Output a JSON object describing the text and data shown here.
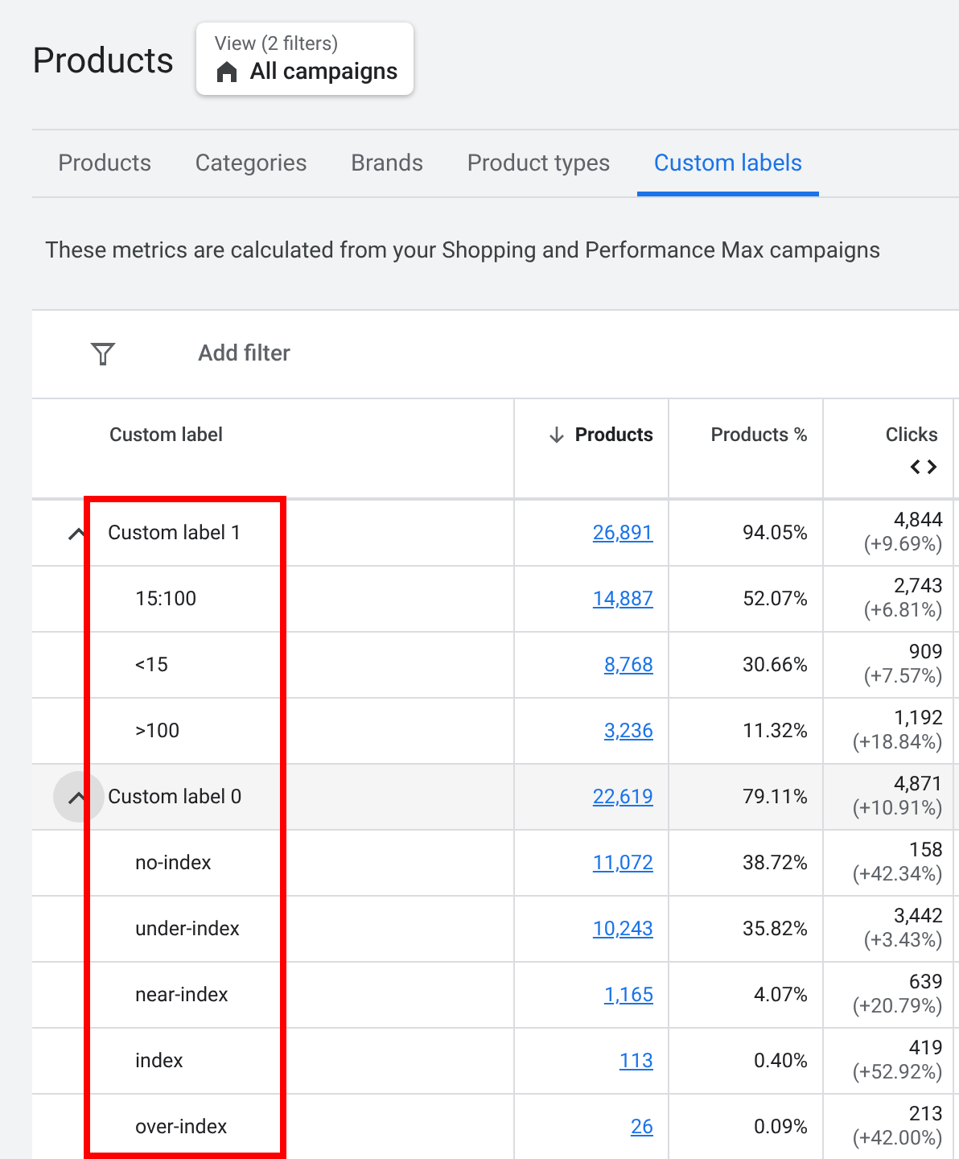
{
  "page": {
    "title": "Products",
    "view": {
      "label": "View (2 filters)",
      "value": "All campaigns"
    }
  },
  "tabs": [
    {
      "label": "Products",
      "selected": false
    },
    {
      "label": "Categories",
      "selected": false
    },
    {
      "label": "Brands",
      "selected": false
    },
    {
      "label": "Product types",
      "selected": false
    },
    {
      "label": "Custom labels",
      "selected": true
    }
  ],
  "description": "These metrics are calculated from your Shopping and Performance Max campaigns",
  "filter": {
    "label": "Add filter"
  },
  "table": {
    "columns": [
      {
        "label": "Custom label",
        "sorted": false
      },
      {
        "label": "Products",
        "sorted": true
      },
      {
        "label": "Products %",
        "sorted": false
      },
      {
        "label": "Clicks",
        "sorted": false
      }
    ],
    "rows": [
      {
        "label": "Custom label 1",
        "expanded": true,
        "hovered": false,
        "products": "26,891",
        "share": "94.05%",
        "clicks": "4,844",
        "change": "(+9.69%)",
        "children": [
          {
            "label": "15:100",
            "products": "14,887",
            "share": "52.07%",
            "clicks": "2,743",
            "change": "(+6.81%)"
          },
          {
            "label": "<15",
            "products": "8,768",
            "share": "30.66%",
            "clicks": "909",
            "change": "(+7.57%)"
          },
          {
            "label": ">100",
            "products": "3,236",
            "share": "11.32%",
            "clicks": "1,192",
            "change": "(+18.84%)"
          }
        ]
      },
      {
        "label": "Custom label 0",
        "expanded": true,
        "hovered": true,
        "products": "22,619",
        "share": "79.11%",
        "clicks": "4,871",
        "change": "(+10.91%)",
        "children": [
          {
            "label": "no-index",
            "products": "11,072",
            "share": "38.72%",
            "clicks": "158",
            "change": "(+42.34%)"
          },
          {
            "label": "under-index",
            "products": "10,243",
            "share": "35.82%",
            "clicks": "3,442",
            "change": "(+3.43%)"
          },
          {
            "label": "near-index",
            "products": "1,165",
            "share": "4.07%",
            "clicks": "639",
            "change": "(+20.79%)"
          },
          {
            "label": "index",
            "products": "113",
            "share": "0.40%",
            "clicks": "419",
            "change": "(+52.92%)"
          },
          {
            "label": "over-index",
            "products": "26",
            "share": "0.09%",
            "clicks": "213",
            "change": "(+42.00%)"
          }
        ]
      }
    ]
  }
}
